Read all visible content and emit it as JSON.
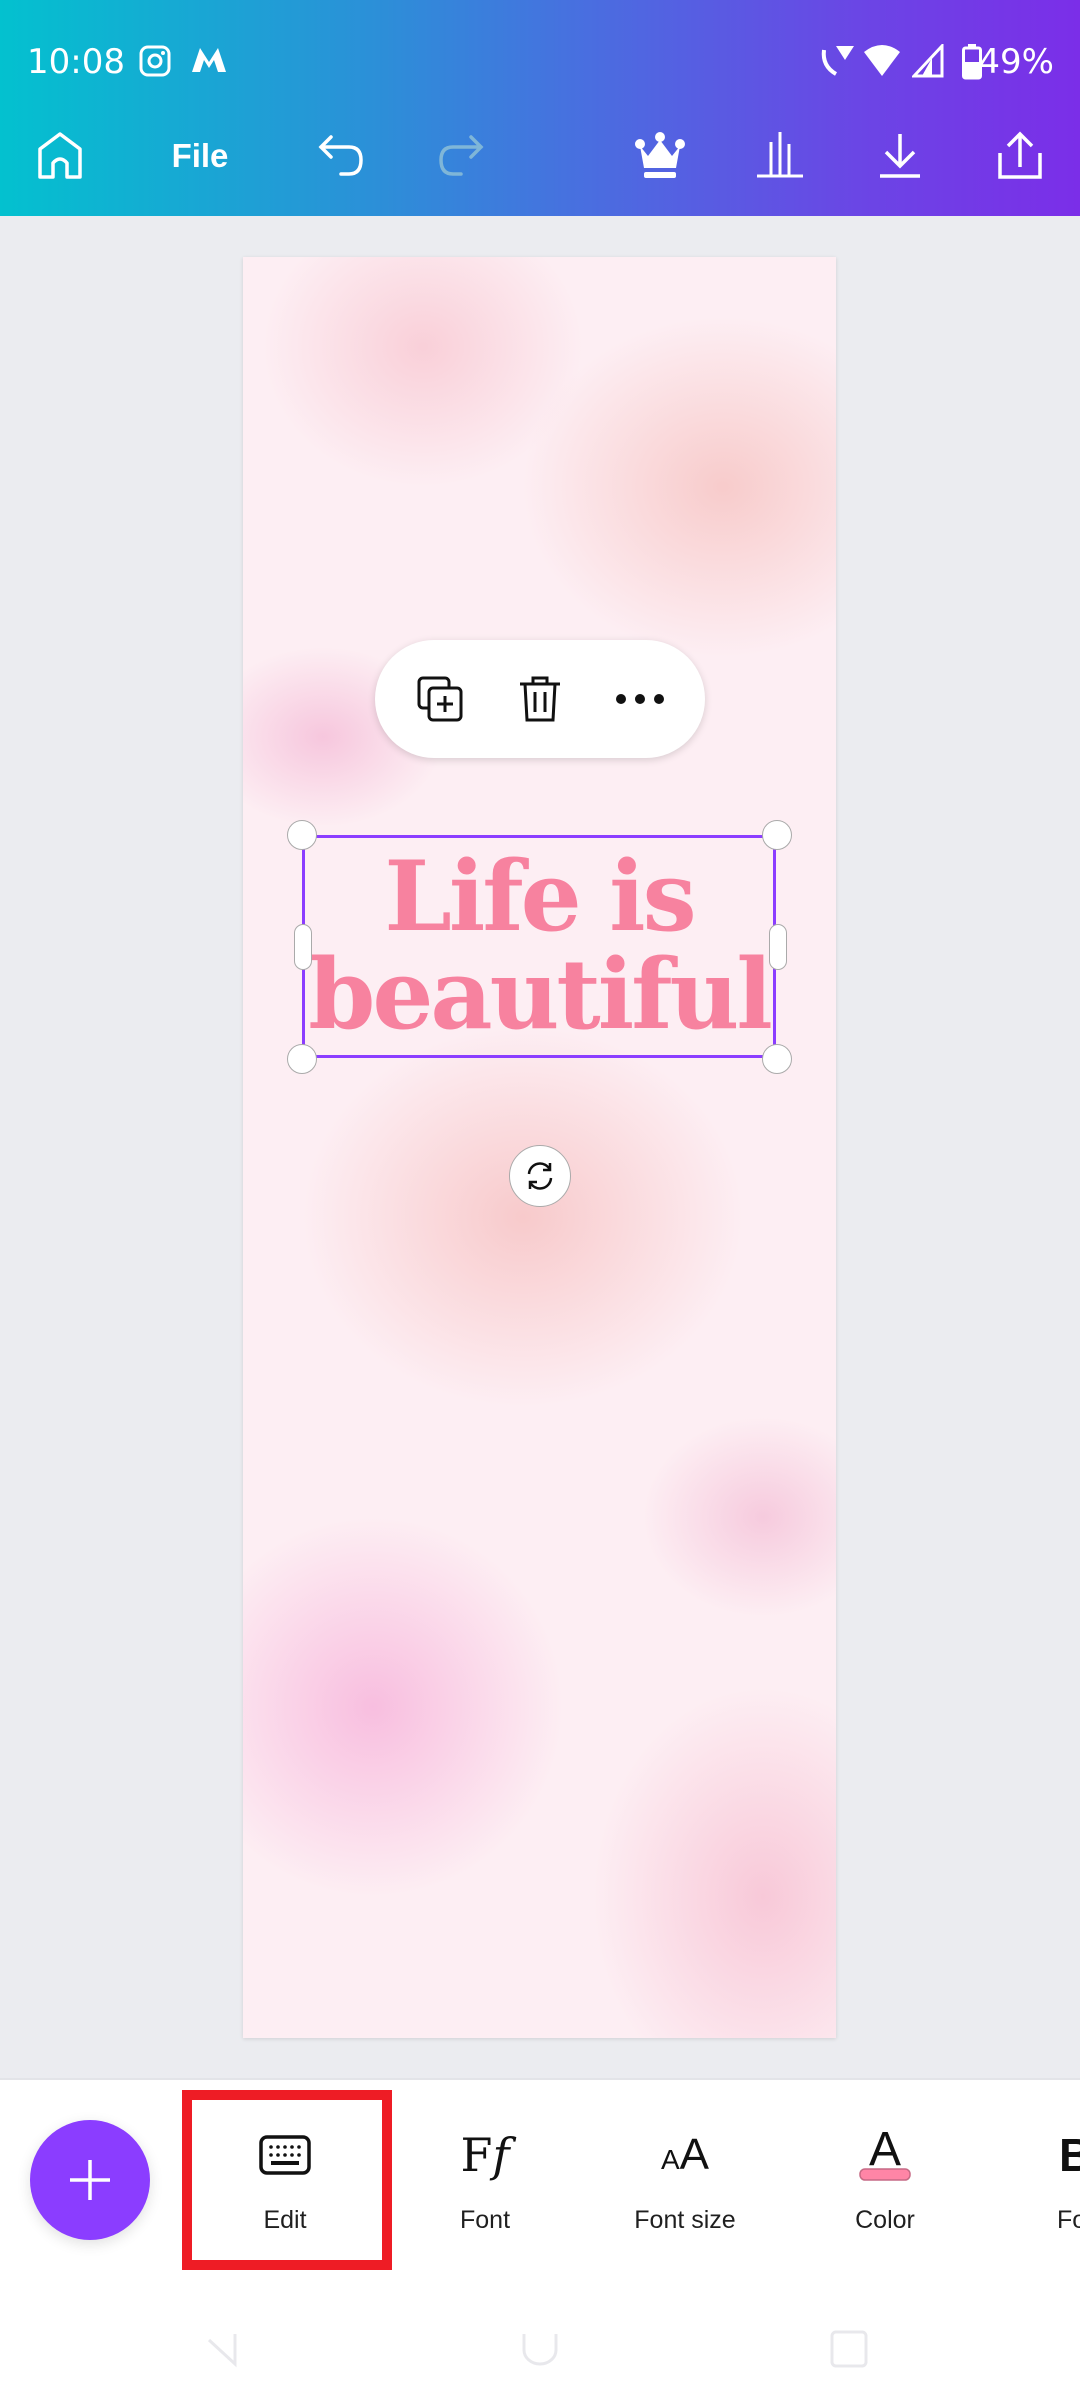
{
  "status_bar": {
    "time": "10:08",
    "battery": "49%",
    "icons": [
      "instagram-icon",
      "m-app-icon",
      "wifi-call-icon",
      "wifi-icon",
      "signal-icon",
      "battery-icon"
    ]
  },
  "toolbar": {
    "file_label": "File",
    "icons": [
      "home-icon",
      "undo-icon",
      "redo-icon",
      "crown-icon",
      "chart-icon",
      "download-icon",
      "share-icon"
    ]
  },
  "canvas": {
    "text_line1": "Life is",
    "text_line2": "beautiful",
    "text_color": "#f7829f",
    "selection_color": "#8b3dff"
  },
  "float_menu": {
    "icons": [
      "duplicate-icon",
      "trash-icon",
      "more-icon"
    ]
  },
  "bottom_toolbar": {
    "add_button_color": "#8b3dff",
    "tools": [
      {
        "label": "Edit",
        "icon": "keyboard-icon"
      },
      {
        "label": "Font",
        "icon": "font-icon"
      },
      {
        "label": "Font size",
        "icon": "font-size-icon"
      },
      {
        "label": "Color",
        "icon": "text-color-icon"
      },
      {
        "label": "For",
        "icon": "bold-icon"
      }
    ],
    "highlight_color": "#ee1c25"
  }
}
